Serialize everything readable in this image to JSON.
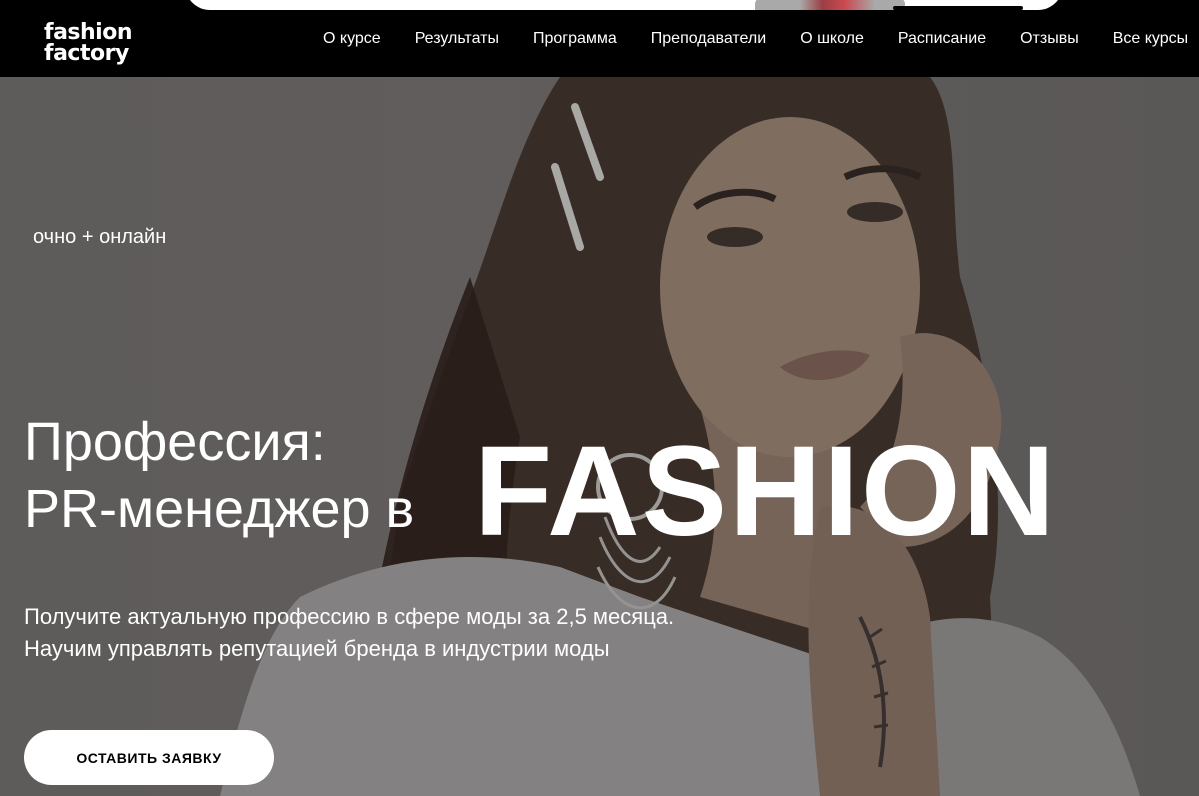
{
  "header": {
    "logo_line1": "fashion",
    "logo_line2": "factory",
    "nav": [
      {
        "label": "О курсе"
      },
      {
        "label": "Результаты"
      },
      {
        "label": "Программа"
      },
      {
        "label": "Преподаватели"
      },
      {
        "label": "О школе"
      },
      {
        "label": "Расписание"
      },
      {
        "label": "Отзывы"
      },
      {
        "label": "Все курсы"
      }
    ]
  },
  "hero": {
    "mode_tag": "очно + онлайн",
    "title_line1": "Профессия:",
    "title_line2": "PR-менеджер в",
    "title_highlight": "FASHION",
    "subtitle_line1": "Получите актуальную профессию в сфере моды за 2,5 месяца.",
    "subtitle_line2": "Научим управлять репутацией бренда в индустрии моды",
    "cta_label": "ОСТАВИТЬ ЗАЯВКУ"
  },
  "colors": {
    "header_bg": "#000000",
    "hero_overlay": "#6e6b6a",
    "text": "#ffffff",
    "cta_bg": "#ffffff",
    "cta_text": "#000000"
  }
}
